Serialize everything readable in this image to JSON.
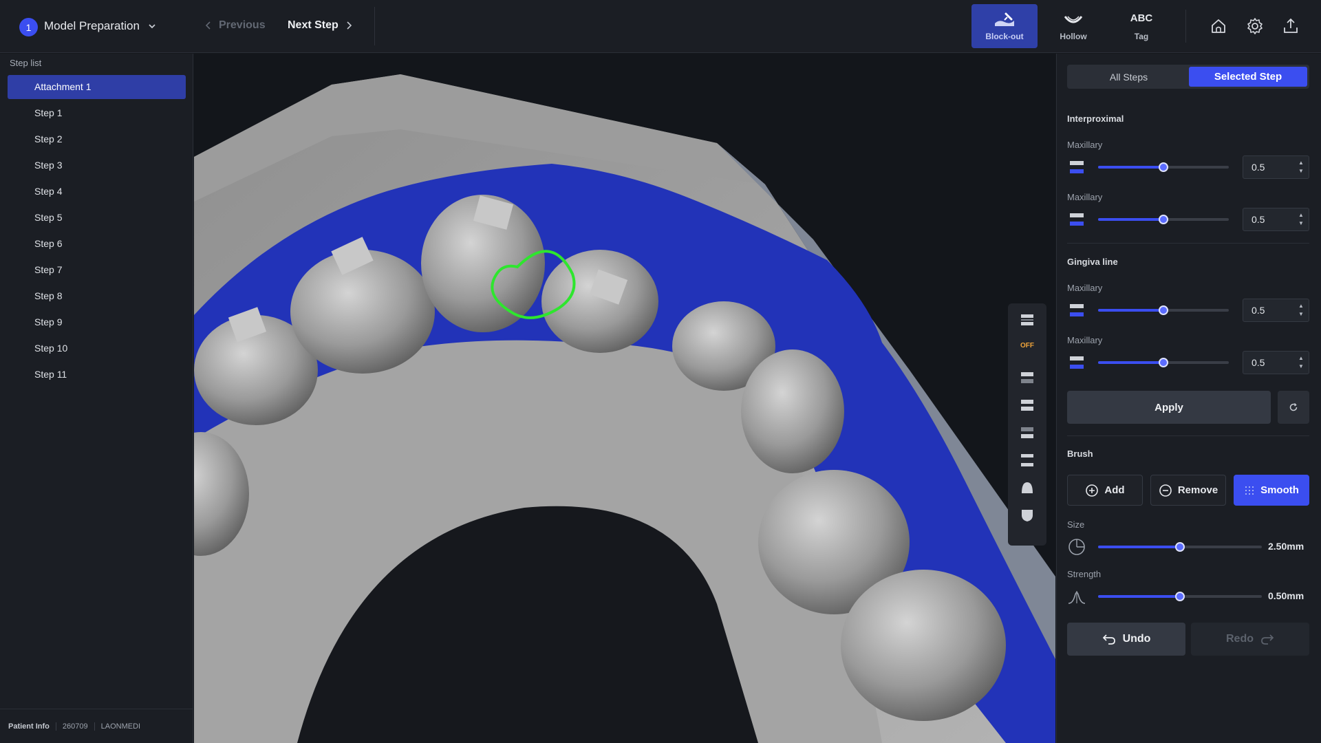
{
  "header": {
    "stage_number": "1",
    "stage_title": "Model Preparation",
    "previous_label": "Previous",
    "next_label": "Next Step",
    "tools": [
      {
        "label": "Block-out",
        "icon": "block-out-icon",
        "active": true
      },
      {
        "label": "Hollow",
        "icon": "hollow-icon",
        "active": false
      },
      {
        "label": "Tag",
        "icon_text": "ABC",
        "active": false
      }
    ],
    "actions": [
      "home-icon",
      "gear-icon",
      "upload-icon"
    ]
  },
  "sidebar": {
    "title": "Step list",
    "items": [
      {
        "label": "Attachment 1",
        "active": true
      },
      {
        "label": "Step 1"
      },
      {
        "label": "Step 2"
      },
      {
        "label": "Step 3"
      },
      {
        "label": "Step 4"
      },
      {
        "label": "Step 5"
      },
      {
        "label": "Step 6"
      },
      {
        "label": "Step 7"
      },
      {
        "label": "Step 8"
      },
      {
        "label": "Step 9"
      },
      {
        "label": "Step 10"
      },
      {
        "label": "Step 11"
      }
    ],
    "patient": {
      "label": "Patient Info",
      "id": "260709",
      "org": "LAONMEDI"
    }
  },
  "viewport": {
    "toolbar_off_label": "OFF"
  },
  "panel": {
    "tabs": {
      "all": "All Steps",
      "selected": "Selected Step"
    },
    "interproximal": {
      "title": "Interproximal",
      "rows": [
        {
          "label": "Maxillary",
          "value": "0.5",
          "level": 0.5
        },
        {
          "label": "Maxillary",
          "value": "0.5",
          "level": 0.5
        }
      ]
    },
    "gingiva": {
      "title": "Gingiva line",
      "rows": [
        {
          "label": "Maxillary",
          "value": "0.5",
          "level": 0.5
        },
        {
          "label": "Maxillary",
          "value": "0.5",
          "level": 0.5
        }
      ]
    },
    "apply_label": "Apply",
    "brush": {
      "title": "Brush",
      "modes": [
        {
          "label": "Add",
          "active": false
        },
        {
          "label": "Remove",
          "active": false
        },
        {
          "label": "Smooth",
          "active": true
        }
      ],
      "size": {
        "label": "Size",
        "value": "2.50mm",
        "level": 0.5
      },
      "strength": {
        "label": "Strength",
        "value": "0.50mm",
        "level": 0.5
      }
    },
    "undo_label": "Undo",
    "redo_label": "Redo"
  },
  "colors": {
    "accent": "#3b4ef0",
    "selection_outline": "#2ee62e",
    "blockout": "#2233b8"
  }
}
